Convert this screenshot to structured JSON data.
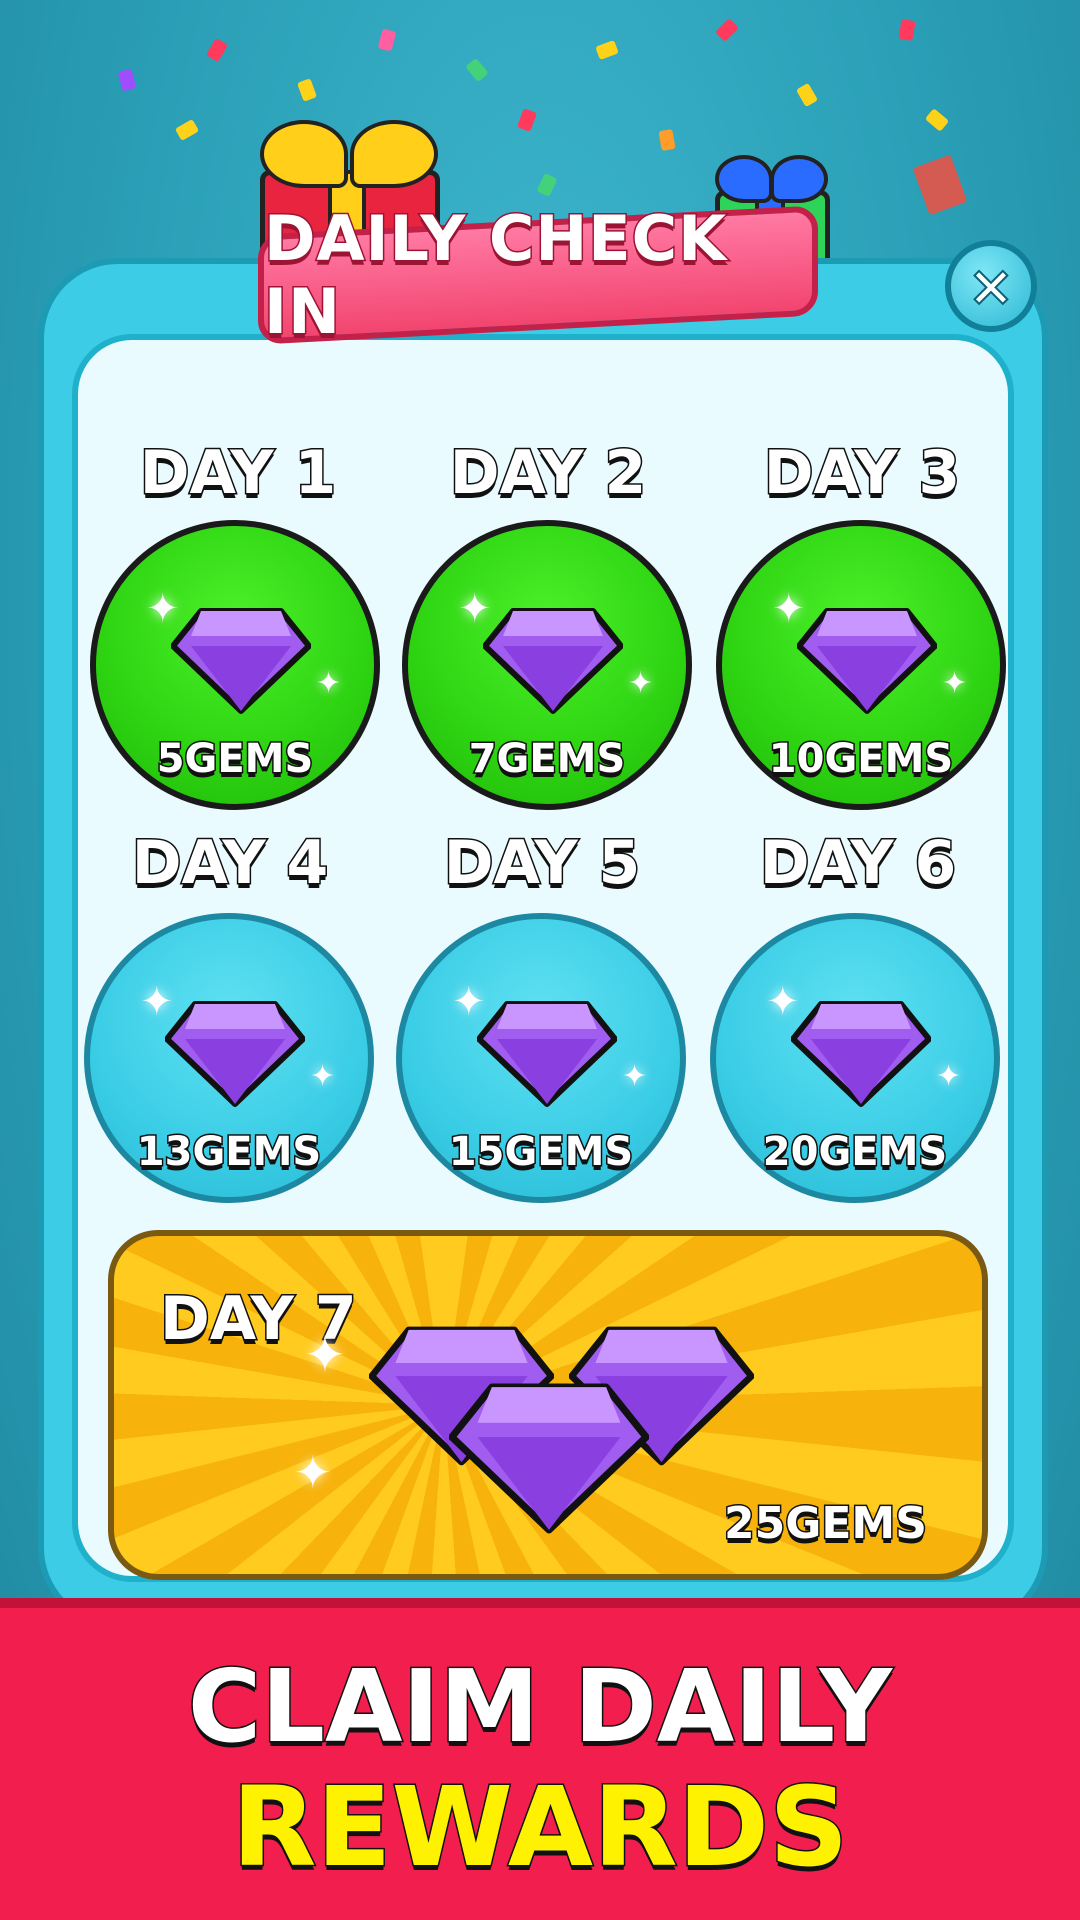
{
  "header": {
    "title": "DAILY CHECK IN",
    "close_label": "×"
  },
  "days": [
    {
      "label": "DAY 1",
      "reward": "5GEMS",
      "status": "claimed"
    },
    {
      "label": "DAY 2",
      "reward": "7GEMS",
      "status": "claimed"
    },
    {
      "label": "DAY 3",
      "reward": "10GEMS",
      "status": "claimed"
    },
    {
      "label": "DAY 4",
      "reward": "13GEMS",
      "status": "locked"
    },
    {
      "label": "DAY 5",
      "reward": "15GEMS",
      "status": "locked"
    },
    {
      "label": "DAY 6",
      "reward": "20GEMS",
      "status": "locked"
    }
  ],
  "day7": {
    "label": "DAY 7",
    "reward": "25GEMS"
  },
  "footer": {
    "line1": "CLAIM DAILY",
    "line2": "REWARDS"
  },
  "icons": {
    "gem": "purple-gem-icon",
    "close": "close-icon",
    "gift": "gift-box-icon",
    "sparkle": "sparkle-icon"
  },
  "colors": {
    "claimed": "#2dd311",
    "locked": "#3acde6",
    "banner": "#f2456f",
    "footer": "#f21f4e",
    "footer_accent": "#fff200"
  }
}
